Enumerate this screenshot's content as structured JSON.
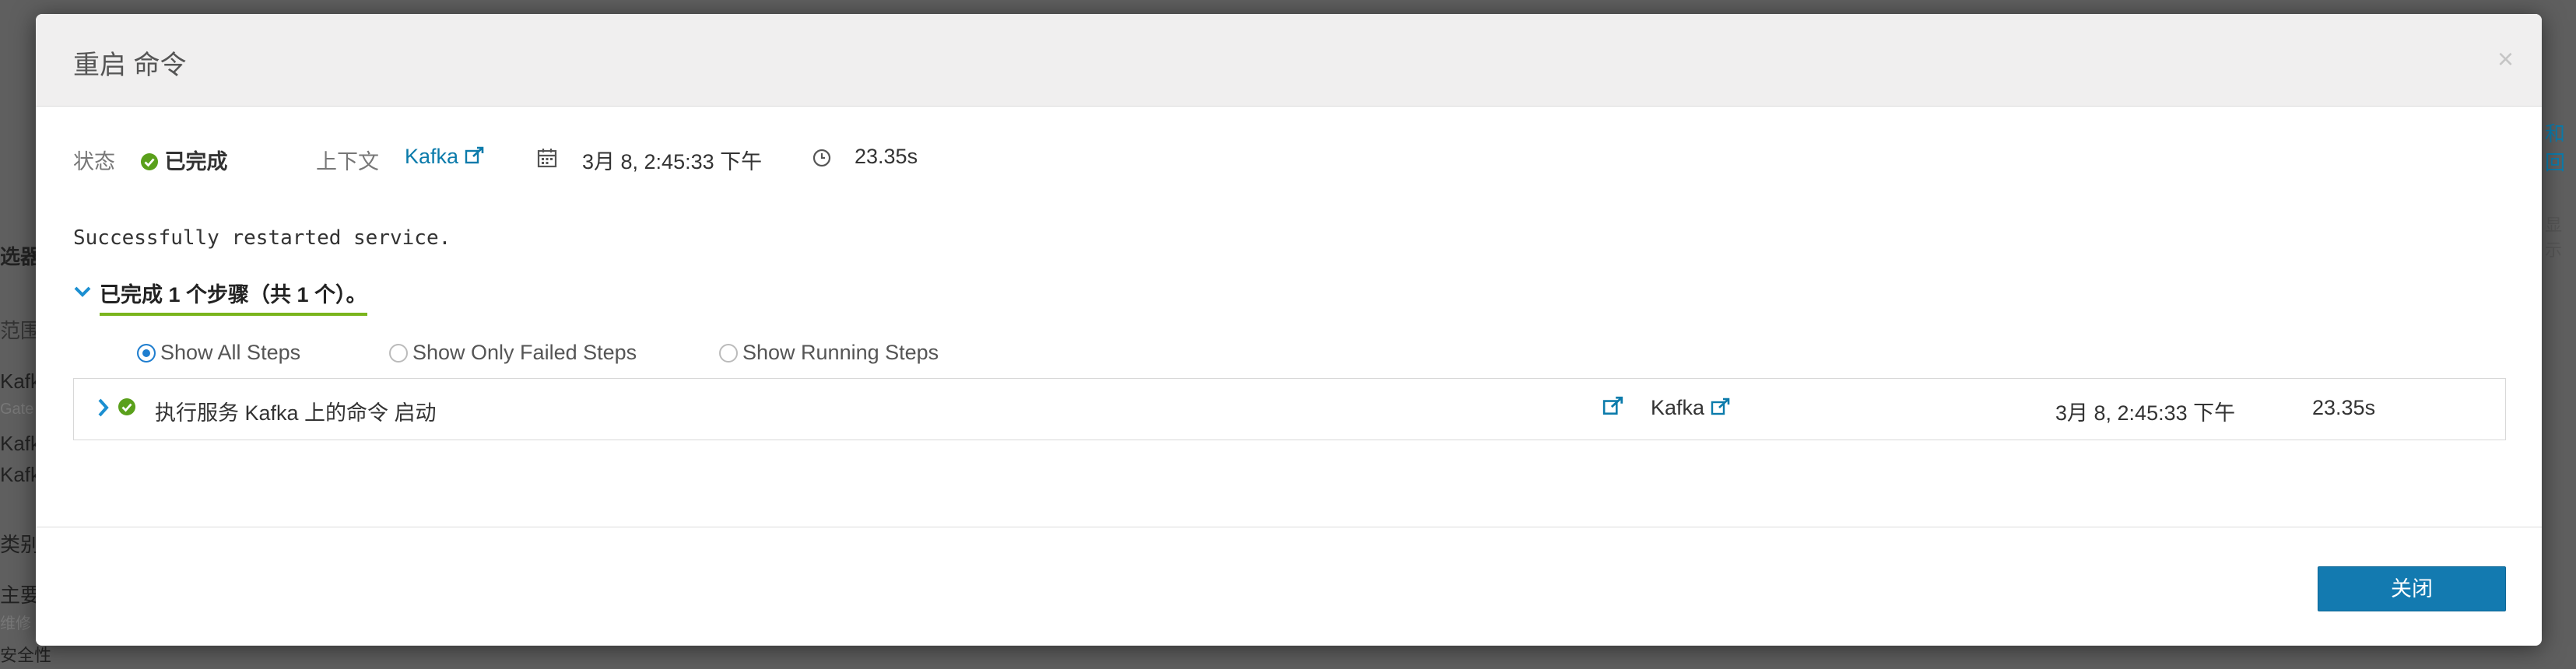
{
  "background": {
    "left_fragments": [
      "选器",
      "范围",
      "Kafk",
      "Gate",
      "Kafk",
      "Kafk",
      "类别",
      "主要",
      "维修",
      "安全性"
    ],
    "right_fragments": [
      "和回",
      "显示"
    ]
  },
  "modal": {
    "title": "重启 命令",
    "close_icon": "×",
    "meta": {
      "status_label": "状态",
      "status_value": "已完成",
      "context_label": "上下文",
      "context_link": "Kafka",
      "date": "3月 8, 2:45:33 下午",
      "duration": "23.35s"
    },
    "message": "Successfully restarted service.",
    "steps_summary": "已完成 1 个步骤（共 1 个）。",
    "filters": {
      "all": "Show All Steps",
      "failed": "Show Only Failed Steps",
      "running": "Show Running Steps",
      "selected": "all"
    },
    "steps": [
      {
        "name": "执行服务 Kafka 上的命令 启动",
        "context": "Kafka",
        "time": "3月 8, 2:45:33 下午",
        "duration": "23.35s"
      }
    ],
    "close_button": "关闭"
  },
  "colors": {
    "accent": "#137ab0",
    "link": "#0b7bab",
    "success": "#5aa01b",
    "underline": "#7ab51d"
  }
}
